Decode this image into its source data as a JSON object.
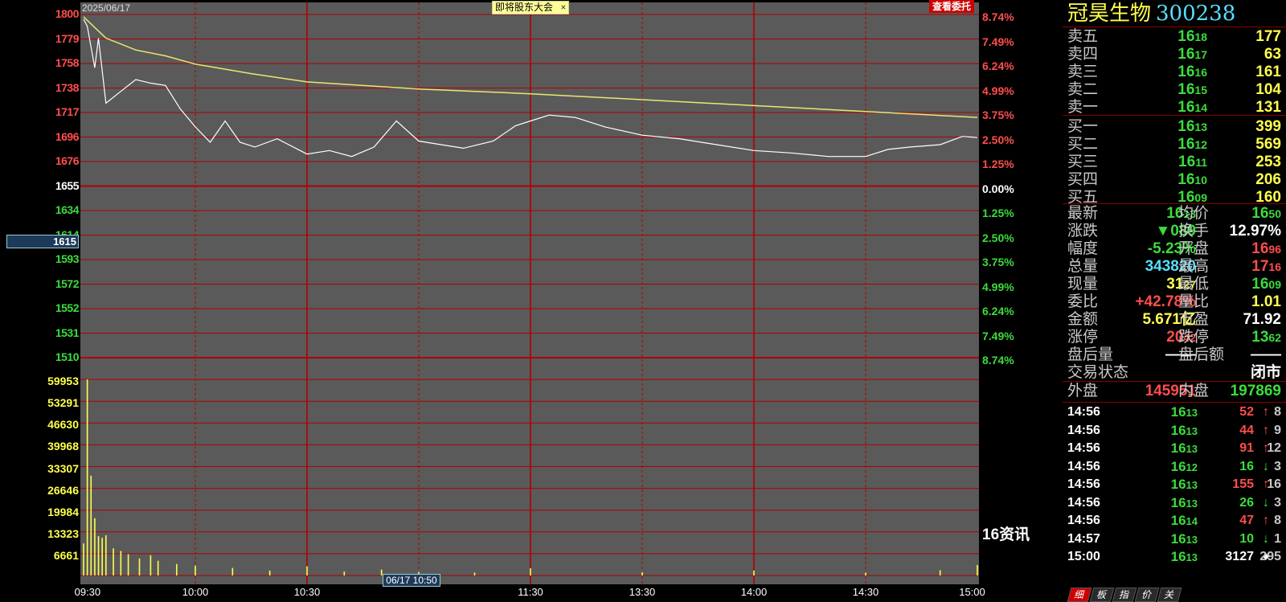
{
  "chart": {
    "date": "2025/06/17",
    "banner": "即将股东大会",
    "banner_close": "×",
    "entrust_button": "查看委托",
    "cursor_price": "1615",
    "cursor_time": "06/17 10:50",
    "news_label": "16资讯",
    "price_ticks": [
      {
        "label": "1800",
        "color": "red"
      },
      {
        "label": "1779",
        "color": "red"
      },
      {
        "label": "1758",
        "color": "red"
      },
      {
        "label": "1738",
        "color": "red"
      },
      {
        "label": "1717",
        "color": "red"
      },
      {
        "label": "1696",
        "color": "red"
      },
      {
        "label": "1676",
        "color": "red"
      },
      {
        "label": "1655",
        "color": "white"
      },
      {
        "label": "1634",
        "color": "green"
      },
      {
        "label": "1614",
        "color": "green"
      },
      {
        "label": "1593",
        "color": "green"
      },
      {
        "label": "1572",
        "color": "green"
      },
      {
        "label": "1552",
        "color": "green"
      },
      {
        "label": "1531",
        "color": "green"
      },
      {
        "label": "1510",
        "color": "green"
      }
    ],
    "pct_ticks": [
      {
        "label": "8.74%",
        "color": "red"
      },
      {
        "label": "7.49%",
        "color": "red"
      },
      {
        "label": "6.24%",
        "color": "red"
      },
      {
        "label": "4.99%",
        "color": "red"
      },
      {
        "label": "3.75%",
        "color": "red"
      },
      {
        "label": "2.50%",
        "color": "red"
      },
      {
        "label": "1.25%",
        "color": "red"
      },
      {
        "label": "0.00%",
        "color": "white"
      },
      {
        "label": "1.25%",
        "color": "green"
      },
      {
        "label": "2.50%",
        "color": "green"
      },
      {
        "label": "3.75%",
        "color": "green"
      },
      {
        "label": "4.99%",
        "color": "green"
      },
      {
        "label": "6.24%",
        "color": "green"
      },
      {
        "label": "7.49%",
        "color": "green"
      },
      {
        "label": "8.74%",
        "color": "green"
      }
    ],
    "volume_ticks": [
      "59953",
      "53291",
      "46630",
      "39968",
      "33307",
      "26646",
      "19984",
      "13323",
      "6661"
    ],
    "time_ticks": [
      "09:30",
      "10:00",
      "10:30",
      "11:30",
      "13:30",
      "14:00",
      "14:30",
      "15:00"
    ]
  },
  "chart_data": {
    "type": "line",
    "title": "",
    "xlabel": "",
    "ylabel": "",
    "ylim": [
      15.1,
      18.0
    ],
    "prev_close": 16.55,
    "price_series": [
      {
        "t": "09:30",
        "v": 17.96
      },
      {
        "t": "09:31",
        "v": 17.9
      },
      {
        "t": "09:33",
        "v": 17.55
      },
      {
        "t": "09:34",
        "v": 17.8
      },
      {
        "t": "09:36",
        "v": 17.25
      },
      {
        "t": "09:40",
        "v": 17.35
      },
      {
        "t": "09:44",
        "v": 17.45
      },
      {
        "t": "09:48",
        "v": 17.42
      },
      {
        "t": "09:52",
        "v": 17.4
      },
      {
        "t": "09:56",
        "v": 17.2
      },
      {
        "t": "10:00",
        "v": 17.05
      },
      {
        "t": "10:04",
        "v": 16.92
      },
      {
        "t": "10:08",
        "v": 17.1
      },
      {
        "t": "10:12",
        "v": 16.92
      },
      {
        "t": "10:16",
        "v": 16.88
      },
      {
        "t": "10:22",
        "v": 16.95
      },
      {
        "t": "10:30",
        "v": 16.82
      },
      {
        "t": "10:36",
        "v": 16.85
      },
      {
        "t": "10:42",
        "v": 16.8
      },
      {
        "t": "10:48",
        "v": 16.88
      },
      {
        "t": "10:54",
        "v": 17.1
      },
      {
        "t": "11:00",
        "v": 16.93
      },
      {
        "t": "11:06",
        "v": 16.9
      },
      {
        "t": "11:12",
        "v": 16.87
      },
      {
        "t": "11:20",
        "v": 16.93
      },
      {
        "t": "11:26",
        "v": 17.06
      },
      {
        "t": "11:30",
        "v": 17.1
      },
      {
        "t": "13:05",
        "v": 17.15
      },
      {
        "t": "13:12",
        "v": 17.13
      },
      {
        "t": "13:20",
        "v": 17.05
      },
      {
        "t": "13:30",
        "v": 16.98
      },
      {
        "t": "13:40",
        "v": 16.95
      },
      {
        "t": "13:50",
        "v": 16.9
      },
      {
        "t": "14:00",
        "v": 16.85
      },
      {
        "t": "14:10",
        "v": 16.83
      },
      {
        "t": "14:20",
        "v": 16.8
      },
      {
        "t": "14:30",
        "v": 16.8
      },
      {
        "t": "14:36",
        "v": 16.86
      },
      {
        "t": "14:42",
        "v": 16.88
      },
      {
        "t": "14:50",
        "v": 16.9
      },
      {
        "t": "14:56",
        "v": 16.97
      },
      {
        "t": "15:00",
        "v": 16.96
      }
    ],
    "avg_series": [
      {
        "t": "09:30",
        "v": 17.98
      },
      {
        "t": "09:36",
        "v": 17.8
      },
      {
        "t": "09:44",
        "v": 17.7
      },
      {
        "t": "09:52",
        "v": 17.65
      },
      {
        "t": "10:00",
        "v": 17.58
      },
      {
        "t": "10:15",
        "v": 17.5
      },
      {
        "t": "10:30",
        "v": 17.43
      },
      {
        "t": "11:00",
        "v": 17.37
      },
      {
        "t": "11:30",
        "v": 17.33
      },
      {
        "t": "13:30",
        "v": 17.28
      },
      {
        "t": "14:00",
        "v": 17.23
      },
      {
        "t": "14:30",
        "v": 17.18
      },
      {
        "t": "15:00",
        "v": 17.13
      }
    ],
    "volume_series": [
      {
        "t": "09:30",
        "v": 9800
      },
      {
        "t": "09:31",
        "v": 59953
      },
      {
        "t": "09:32",
        "v": 30500
      },
      {
        "t": "09:33",
        "v": 17500
      },
      {
        "t": "09:34",
        "v": 12000
      },
      {
        "t": "09:35",
        "v": 11500
      },
      {
        "t": "09:36",
        "v": 12300
      },
      {
        "t": "09:38",
        "v": 8300
      },
      {
        "t": "09:40",
        "v": 7500
      },
      {
        "t": "09:42",
        "v": 6500
      },
      {
        "t": "09:45",
        "v": 5200
      },
      {
        "t": "09:48",
        "v": 6200
      },
      {
        "t": "09:50",
        "v": 4500
      },
      {
        "t": "09:55",
        "v": 3500
      },
      {
        "t": "10:00",
        "v": 3000
      },
      {
        "t": "10:10",
        "v": 2300
      },
      {
        "t": "10:20",
        "v": 1500
      },
      {
        "t": "10:30",
        "v": 2800
      },
      {
        "t": "10:40",
        "v": 1200
      },
      {
        "t": "10:50",
        "v": 1800
      },
      {
        "t": "11:00",
        "v": 1100
      },
      {
        "t": "11:15",
        "v": 900
      },
      {
        "t": "11:30",
        "v": 2200
      },
      {
        "t": "13:30",
        "v": 1000
      },
      {
        "t": "14:00",
        "v": 1500
      },
      {
        "t": "14:30",
        "v": 900
      },
      {
        "t": "14:50",
        "v": 1600
      },
      {
        "t": "15:00",
        "v": 3200
      }
    ]
  },
  "quote": {
    "name": "冠昊生物",
    "code": "300238",
    "sells": [
      {
        "label": "卖五",
        "price": "1618",
        "qty": "177"
      },
      {
        "label": "卖四",
        "price": "1617",
        "qty": "63"
      },
      {
        "label": "卖三",
        "price": "1616",
        "qty": "161"
      },
      {
        "label": "卖二",
        "price": "1615",
        "qty": "104"
      },
      {
        "label": "卖一",
        "price": "1614",
        "qty": "131"
      }
    ],
    "buys": [
      {
        "label": "买一",
        "price": "1613",
        "qty": "399"
      },
      {
        "label": "买二",
        "price": "1612",
        "qty": "569"
      },
      {
        "label": "买三",
        "price": "1611",
        "qty": "253"
      },
      {
        "label": "买四",
        "price": "1610",
        "qty": "206"
      },
      {
        "label": "买五",
        "price": "1609",
        "qty": "160"
      }
    ],
    "stats": [
      {
        "l1": "最新",
        "v1": "1613",
        "c1": "green",
        "l2": "均价",
        "v2": "1650",
        "c2": "green"
      },
      {
        "l1": "涨跌",
        "v1": "▼089",
        "c1": "green",
        "l2": "换手",
        "v2": "12.97%",
        "c2": "white"
      },
      {
        "l1": "幅度",
        "v1": "-5.23%",
        "c1": "green",
        "l2": "开盘",
        "v2": "1696",
        "c2": "red"
      },
      {
        "l1": "总量",
        "v1": "343820",
        "c1": "cyan",
        "l2": "最高",
        "v2": "1716",
        "c2": "red"
      },
      {
        "l1": "现量",
        "v1": "3127",
        "c1": "yellow",
        "l2": "最低",
        "v2": "1609",
        "c2": "green"
      },
      {
        "l1": "委比",
        "v1": "+42.78%",
        "c1": "red",
        "l2": "量比",
        "v2": "1.01",
        "c2": "yellow"
      },
      {
        "l1": "金额",
        "v1": "5.671亿",
        "c1": "yellow",
        "l2": "市盈",
        "v2": "71.92",
        "c2": "white"
      },
      {
        "l1": "涨停",
        "v1": "2042",
        "c1": "red",
        "l2": "跌停",
        "v2": "1362",
        "c2": "green"
      },
      {
        "l1": "盘后量",
        "v1": "——",
        "c1": "white",
        "l2": "盘后额",
        "v2": "——",
        "c2": "white"
      },
      {
        "l1": "交易状态",
        "v1": "",
        "c1": "white",
        "l2": "",
        "v2": "闭市",
        "c2": "white"
      }
    ],
    "outer_label": "外盘",
    "outer_value": "145951",
    "inner_label": "内盘",
    "inner_value": "197869",
    "trades": [
      {
        "time": "14:56",
        "price": "1613",
        "vol": "52",
        "dir": "up",
        "n": "8"
      },
      {
        "time": "14:56",
        "price": "1613",
        "vol": "44",
        "dir": "up",
        "n": "9"
      },
      {
        "time": "14:56",
        "price": "1613",
        "vol": "91",
        "dir": "up",
        "n": "12"
      },
      {
        "time": "14:56",
        "price": "1612",
        "vol": "16",
        "dir": "down",
        "n": "3"
      },
      {
        "time": "14:56",
        "price": "1613",
        "vol": "155",
        "dir": "up",
        "n": "16"
      },
      {
        "time": "14:56",
        "price": "1613",
        "vol": "26",
        "dir": "down",
        "n": "3"
      },
      {
        "time": "14:56",
        "price": "1614",
        "vol": "47",
        "dir": "up",
        "n": "8"
      },
      {
        "time": "14:57",
        "price": "1613",
        "vol": "10",
        "dir": "down",
        "n": "1"
      },
      {
        "time": "15:00",
        "price": "1613",
        "vol": "3127",
        "dir": "neutral",
        "n": "295"
      }
    ],
    "tabs": [
      "细",
      "板",
      "指",
      "价",
      "关"
    ]
  },
  "colors": {
    "up": "#ff4d4d",
    "down": "#3cdc3c",
    "grid": "#b00000",
    "plot_bg": "#5a5a5a",
    "avg_line": "#e8e870"
  }
}
